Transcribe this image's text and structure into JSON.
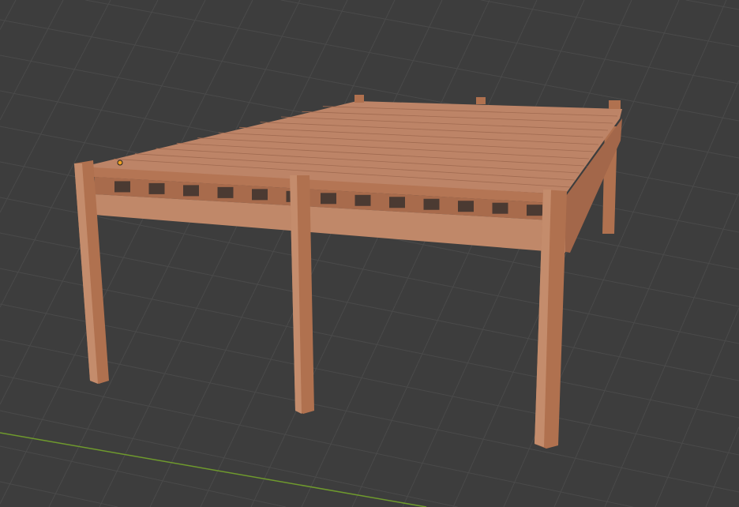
{
  "viewport": {
    "background_color": "#3d3d3d",
    "grid_color": "#4a4a4a",
    "x_axis_color": "#6f9a2d",
    "origin_marker_color": "#f0a020"
  },
  "model": {
    "wood_top_color": "#bd8467",
    "wood_side_color": "#b0714f",
    "wood_shadow_color": "#8e5a3f",
    "wood_light_color": "#cf9a7c"
  }
}
